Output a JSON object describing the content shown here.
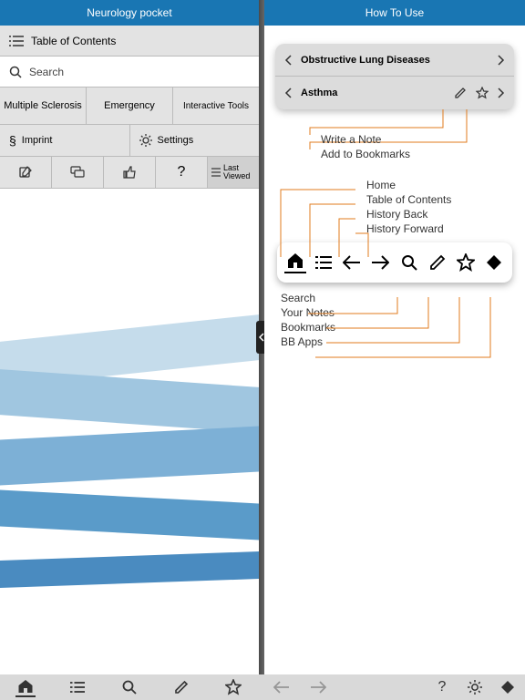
{
  "left": {
    "title": "Neurology pocket",
    "toc": "Table of Contents",
    "search": "Search",
    "buttons": {
      "multiple_sclerosis": "Multiple Sclerosis",
      "emergency": "Emergency",
      "interactive_tools": "Interactive Tools",
      "imprint": "Imprint",
      "settings": "Settings",
      "last_viewed": "Last Viewed"
    }
  },
  "right": {
    "title": "How To Use",
    "nav": {
      "parent": "Obstructive Lung Diseases",
      "current": "Asthma"
    },
    "callouts_top": {
      "write_note": "Write a Note",
      "add_bookmark": "Add to Bookmarks"
    },
    "callouts_mid": {
      "home": "Home",
      "toc": "Table of Contents",
      "back": "History Back",
      "forward": "History Forward"
    },
    "callouts_bottom": {
      "search": "Search",
      "notes": "Your Notes",
      "bookmarks": "Bookmarks",
      "bbapps": "BB Apps"
    }
  }
}
